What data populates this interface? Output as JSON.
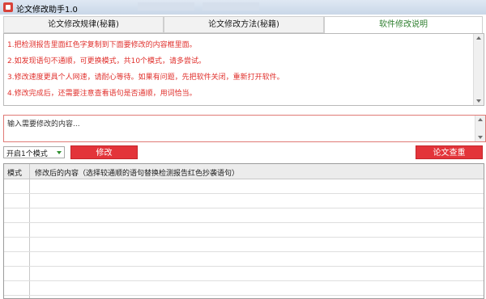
{
  "window": {
    "title": "论文修改助手1.0"
  },
  "tabs": [
    {
      "label": "论文修改规律(秘籍)"
    },
    {
      "label": "论文修改方法(秘籍)"
    },
    {
      "label": "软件修改说明"
    }
  ],
  "notes": [
    "1.把检测报告里面红色字复制到下面要修改的内容框里面。",
    "2.如发现语句不通顺，可更换模式，共10个模式，请多尝试。",
    "3.修改速度更具个人网速，请耐心等待。如果有问题，先把软件关闭，重新打开软件。",
    "4.修改完成后，还需要注意查看语句是否通顺，用词恰当。"
  ],
  "input": {
    "placeholder": "输入需要修改的内容..."
  },
  "mode_select": {
    "value": "开启1个模式"
  },
  "buttons": {
    "modify": "修改",
    "check": "论文查重"
  },
  "grid": {
    "columns": [
      "模式",
      "修改后的内容（选择较通顺的语句替换检测报告红色抄袭语句）"
    ]
  },
  "colors": {
    "accent_red": "#e3343a",
    "note_text": "#e0302c",
    "active_tab": "#2f7f2f"
  }
}
